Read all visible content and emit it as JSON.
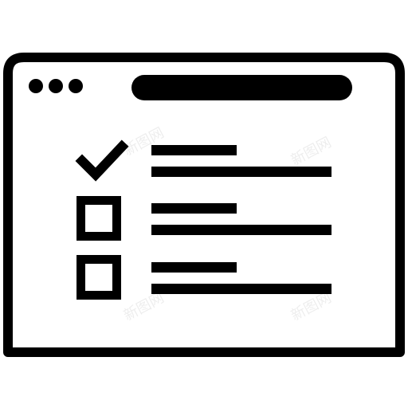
{
  "icon": {
    "name": "browser-checklist-icon",
    "stroke_color": "#000000",
    "fill_color": "#ffffff"
  },
  "window": {
    "controls": [
      "window-dot-1",
      "window-dot-2",
      "window-dot-3"
    ],
    "address_bar": "address-bar"
  },
  "checklist": {
    "items": [
      {
        "state": "checked"
      },
      {
        "state": "unchecked"
      },
      {
        "state": "unchecked"
      }
    ]
  },
  "watermark": {
    "text": "新图网"
  }
}
